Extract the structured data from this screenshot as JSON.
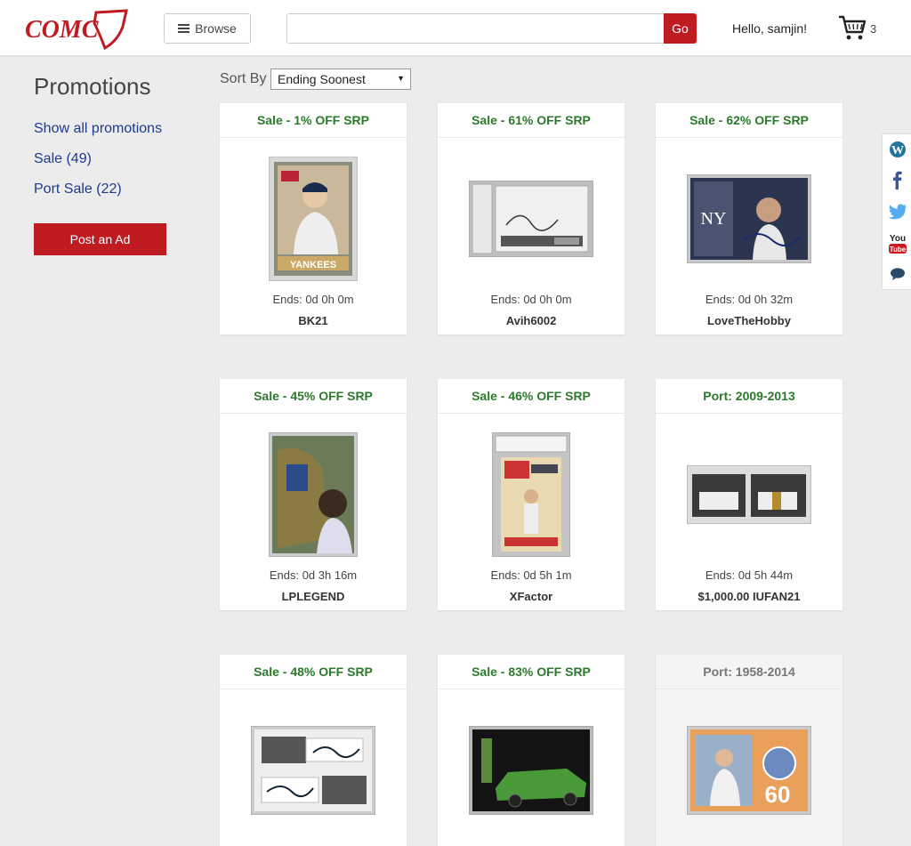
{
  "header": {
    "logo_text": "COMC",
    "browse_label": "Browse",
    "search_placeholder": "",
    "search_value": "",
    "go_label": "Go",
    "greeting": "Hello, samjin!",
    "cart_count": "3"
  },
  "sidebar": {
    "title": "Promotions",
    "links": [
      {
        "label": "Show all promotions"
      },
      {
        "label": "Sale (49)"
      },
      {
        "label": "Port Sale (22)"
      }
    ],
    "post_ad_label": "Post an Ad"
  },
  "sort": {
    "label": "Sort By",
    "selected": "Ending Soonest"
  },
  "cards": [
    {
      "headline": "Sale - 1% OFF SRP",
      "ends": "Ends: 0d 0h 0m",
      "seller": "BK21"
    },
    {
      "headline": "Sale - 61% OFF SRP",
      "ends": "Ends: 0d 0h 0m",
      "seller": "Avih6002"
    },
    {
      "headline": "Sale - 62% OFF SRP",
      "ends": "Ends: 0d 0h 32m",
      "seller": "LoveTheHobby"
    },
    {
      "headline": "Sale - 45% OFF SRP",
      "ends": "Ends: 0d 3h 16m",
      "seller": "LPLEGEND"
    },
    {
      "headline": "Sale - 46% OFF SRP",
      "ends": "Ends: 0d 5h 1m",
      "seller": "XFactor"
    },
    {
      "headline": "Port: 2009-2013",
      "ends": "Ends: 0d 5h 44m",
      "seller": "$1,000.00 IUFAN21"
    },
    {
      "headline": "Sale - 48% OFF SRP",
      "ends": "",
      "seller": ""
    },
    {
      "headline": "Sale - 83% OFF SRP",
      "ends": "",
      "seller": ""
    },
    {
      "headline": "Port: 1958-2014",
      "ends": "",
      "seller": ""
    }
  ],
  "card_images": {
    "c0_text": "YANKEES"
  },
  "social": [
    "wordpress-icon",
    "facebook-icon",
    "twitter-icon",
    "youtube-icon",
    "comment-icon"
  ],
  "social_labels": {
    "youtube_top": "You",
    "youtube_bottom": "Tube"
  },
  "colors": {
    "brand_red": "#c11b22",
    "promo_green": "#2b7a2b",
    "link_blue": "#1f3a8a"
  }
}
